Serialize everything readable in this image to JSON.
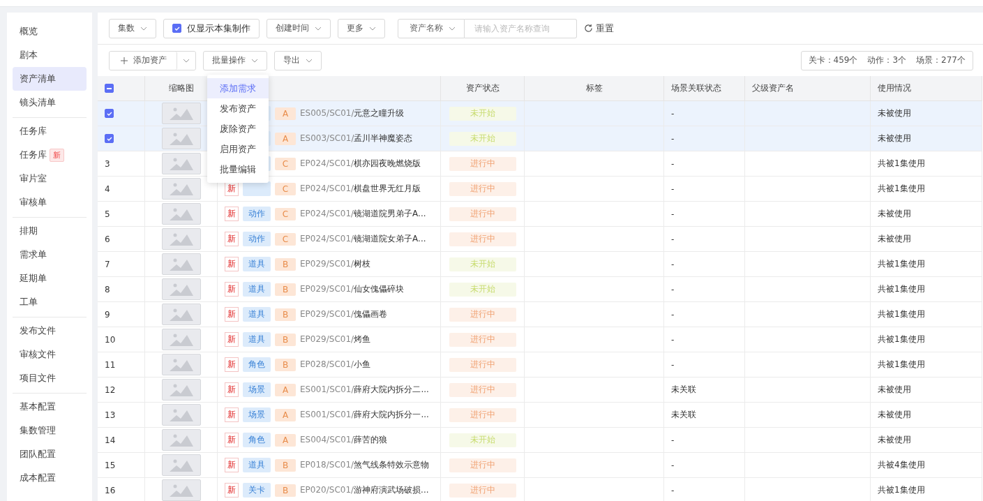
{
  "sidebar": {
    "groups": [
      {
        "items": [
          {
            "label": "概览",
            "selected": false
          },
          {
            "label": "剧本",
            "selected": false
          },
          {
            "label": "资产清单",
            "selected": true
          },
          {
            "label": "镜头清单",
            "selected": false
          }
        ]
      },
      {
        "items": [
          {
            "label": "任务库",
            "selected": false
          },
          {
            "label": "任务库",
            "selected": false,
            "badge": "新"
          },
          {
            "label": "审片室",
            "selected": false
          },
          {
            "label": "审核单",
            "selected": false
          }
        ]
      },
      {
        "items": [
          {
            "label": "排期",
            "selected": false
          },
          {
            "label": "需求单",
            "selected": false
          },
          {
            "label": "延期单",
            "selected": false
          },
          {
            "label": "工单",
            "selected": false
          }
        ]
      },
      {
        "items": [
          {
            "label": "发布文件",
            "selected": false
          },
          {
            "label": "审核文件",
            "selected": false
          },
          {
            "label": "项目文件",
            "selected": false
          }
        ]
      },
      {
        "items": [
          {
            "label": "基本配置",
            "selected": false
          },
          {
            "label": "集数管理",
            "selected": false
          },
          {
            "label": "团队配置",
            "selected": false
          },
          {
            "label": "成本配置",
            "selected": false
          }
        ]
      }
    ]
  },
  "filters": {
    "episode": "集数",
    "only_this_episode": {
      "label": "仅显示本集制作",
      "checked": true
    },
    "created_time": "创建时间",
    "more": "更多",
    "field_select": "资产名称",
    "search": {
      "placeholder": "请输入资产名称查询"
    },
    "reset": "重置"
  },
  "actions": {
    "add": "添加资产",
    "batch": "批量操作",
    "export": "导出",
    "summary": [
      "关卡：459个",
      "动作：3个",
      "场景：277个"
    ]
  },
  "batch_menu": [
    {
      "label": "添加需求",
      "selected": true
    },
    {
      "label": "发布资产",
      "selected": false
    },
    {
      "label": "废除资产",
      "selected": false
    },
    {
      "label": "启用资产",
      "selected": false
    },
    {
      "label": "批量编辑",
      "selected": false
    }
  ],
  "table": {
    "header_indeterminate": true,
    "columns": [
      "缩略图",
      "资产状态",
      "标签",
      "场景关联状态",
      "父级资产名",
      "使用情况"
    ],
    "rows": [
      {
        "selected": true,
        "grade": "A",
        "code": "ES005/SC01/",
        "name": "元意之瞳升级",
        "status": {
          "label": "未开始",
          "color": "#c8dc70"
        },
        "scene_link": "-",
        "usage": "未被使用"
      },
      {
        "selected": true,
        "grade": "A",
        "code": "ES003/SC01/",
        "name": "孟川半神魔姿态",
        "status": {
          "label": "未开始",
          "color": "#c8dc70"
        },
        "scene_link": "-",
        "usage": "未被使用"
      },
      {
        "selected": false,
        "index": "3",
        "grade": "C",
        "code": "EP024/SC01/",
        "name": "棋亦园夜晚燃烧版",
        "status": {
          "label": "进行中",
          "color": "#f0a070"
        },
        "scene_link": "-",
        "usage": "共被1集使用"
      },
      {
        "selected": false,
        "index": "4",
        "new": "新",
        "grade": "C",
        "code": "EP024/SC01/",
        "name": "棋盘世界无红月版",
        "status": {
          "label": "进行中",
          "color": "#f0a070"
        },
        "scene_link": "-",
        "usage": "共被1集使用"
      },
      {
        "selected": false,
        "index": "5",
        "new": "新",
        "type": "动作",
        "grade": "C",
        "code": "EP024/SC01/",
        "name": "镜湖道院男弟子A...",
        "status": {
          "label": "进行中",
          "color": "#f0a070"
        },
        "scene_link": "-",
        "usage": "未被使用"
      },
      {
        "selected": false,
        "index": "6",
        "new": "新",
        "type": "动作",
        "grade": "C",
        "code": "EP024/SC01/",
        "name": "镜湖道院女弟子A...",
        "status": {
          "label": "进行中",
          "color": "#f0a070"
        },
        "scene_link": "-",
        "usage": "未被使用"
      },
      {
        "selected": false,
        "index": "7",
        "new": "新",
        "type": "道具",
        "grade": "B",
        "code": "EP029/SC01/",
        "name": "树枝",
        "status": {
          "label": "未开始",
          "color": "#c8dc70"
        },
        "scene_link": "-",
        "usage": "共被1集使用"
      },
      {
        "selected": false,
        "index": "8",
        "new": "新",
        "type": "道具",
        "grade": "B",
        "code": "EP029/SC01/",
        "name": "仙女傀儡碎块",
        "status": {
          "label": "未开始",
          "color": "#c8dc70"
        },
        "scene_link": "-",
        "usage": "共被1集使用"
      },
      {
        "selected": false,
        "index": "9",
        "new": "新",
        "type": "道具",
        "grade": "B",
        "code": "EP029/SC01/",
        "name": "傀儡画卷",
        "status": {
          "label": "进行中",
          "color": "#f0a070"
        },
        "scene_link": "-",
        "usage": "共被1集使用"
      },
      {
        "selected": false,
        "index": "10",
        "new": "新",
        "type": "道具",
        "grade": "B",
        "code": "EP029/SC01/",
        "name": "烤鱼",
        "status": {
          "label": "进行中",
          "color": "#f0a070"
        },
        "scene_link": "-",
        "usage": "共被1集使用"
      },
      {
        "selected": false,
        "index": "11",
        "new": "新",
        "type": "角色",
        "grade": "B",
        "code": "EP028/SC01/",
        "name": "小鱼",
        "status": {
          "label": "进行中",
          "color": "#f0a070"
        },
        "scene_link": "-",
        "usage": "共被1集使用"
      },
      {
        "selected": false,
        "index": "12",
        "new": "新",
        "type": "场景",
        "grade": "A",
        "code": "ES001/SC01/",
        "name": "薛府大院内拆分二...",
        "status": {
          "label": "进行中",
          "color": "#f0a070"
        },
        "scene_link": "未关联",
        "usage": "未被使用"
      },
      {
        "selected": false,
        "index": "13",
        "new": "新",
        "type": "场景",
        "grade": "A",
        "code": "ES001/SC01/",
        "name": "薛府大院内拆分一...",
        "status": {
          "label": "进行中",
          "color": "#f0a070"
        },
        "scene_link": "未关联",
        "usage": "未被使用"
      },
      {
        "selected": false,
        "index": "14",
        "new": "新",
        "type": "角色",
        "grade": "A",
        "code": "ES004/SC01/",
        "name": "薛苦的狼",
        "status": {
          "label": "未开始",
          "color": "#c8dc70"
        },
        "scene_link": "-",
        "usage": "未被使用"
      },
      {
        "selected": false,
        "index": "15",
        "new": "新",
        "type": "道具",
        "grade": "B",
        "code": "EP018/SC01/",
        "name": "煞气线条特效示意物",
        "status": {
          "label": "进行中",
          "color": "#f0a070"
        },
        "scene_link": "-",
        "usage": "共被4集使用"
      },
      {
        "selected": false,
        "index": "16",
        "new": "新",
        "type": "关卡",
        "grade": "B",
        "code": "EP020/SC01/",
        "name": "游神府演武场破损...",
        "status": {
          "label": "进行中",
          "color": "#f0a070"
        },
        "scene_link": "-",
        "usage": "共被1集使用"
      }
    ]
  }
}
